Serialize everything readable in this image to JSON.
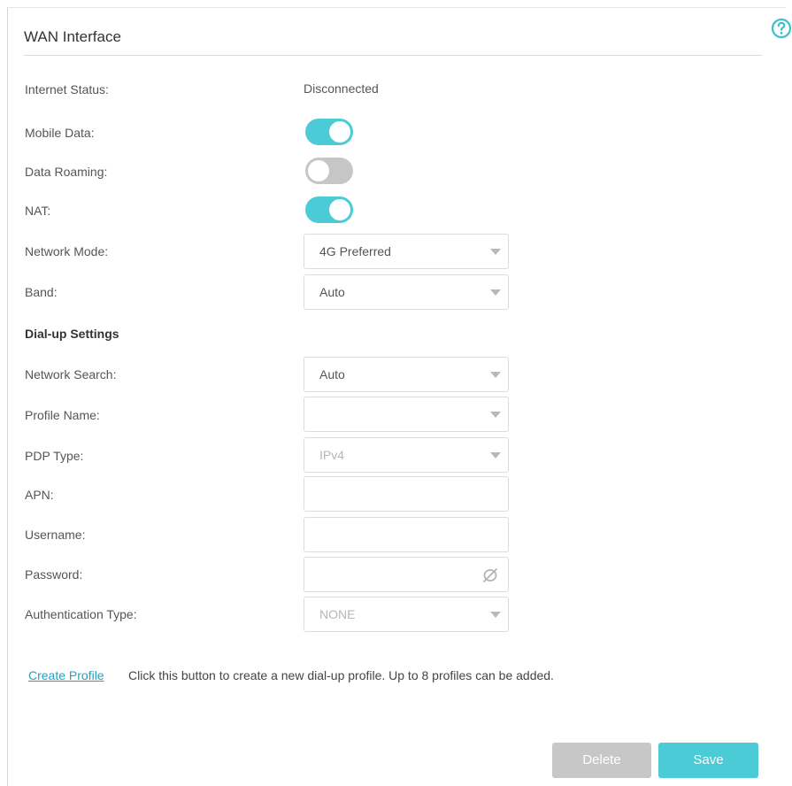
{
  "header": {
    "title": "WAN Interface",
    "help_icon": "help-circle-icon"
  },
  "fields": {
    "internet_status": {
      "label": "Internet Status:",
      "value": "Disconnected"
    },
    "mobile_data": {
      "label": "Mobile Data:",
      "state": "on"
    },
    "data_roaming": {
      "label": "Data Roaming:",
      "state": "off"
    },
    "nat": {
      "label": "NAT:",
      "state": "on"
    },
    "network_mode": {
      "label": "Network Mode:",
      "value": "4G Preferred"
    },
    "band": {
      "label": "Band:",
      "value": "Auto"
    }
  },
  "dialup": {
    "section_title": "Dial-up Settings",
    "network_search": {
      "label": "Network Search:",
      "value": "Auto"
    },
    "profile_name": {
      "label": "Profile Name:",
      "value": ""
    },
    "pdp_type": {
      "label": "PDP Type:",
      "value": "IPv4"
    },
    "apn": {
      "label": "APN:",
      "value": ""
    },
    "username": {
      "label": "Username:",
      "value": ""
    },
    "password": {
      "label": "Password:",
      "value": "",
      "icon": "eye-slash-icon"
    },
    "auth_type": {
      "label": "Authentication Type:",
      "value": "NONE"
    }
  },
  "create_profile": {
    "link": "Create Profile",
    "description": "Click this button to create a new dial-up profile. Up to 8 profiles can be added."
  },
  "buttons": {
    "delete": "Delete",
    "save": "Save"
  },
  "colors": {
    "accent": "#4acbd6",
    "toggle_off": "#c6c6c6",
    "link": "#1ca3c6",
    "disabled_button": "#c7c7c7"
  }
}
